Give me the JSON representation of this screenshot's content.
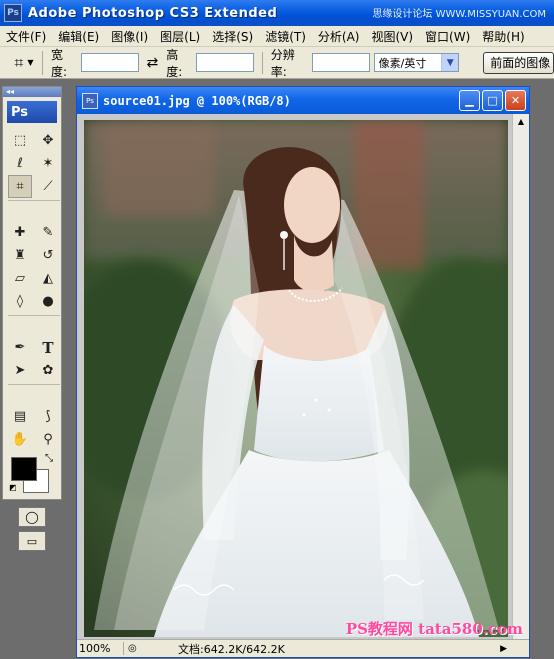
{
  "app": {
    "title": "Adobe Photoshop CS3 Extended",
    "icon": "ps-app-icon",
    "watermark_top": "思缘设计论坛 WWW.MISSYUAN.COM"
  },
  "menubar": {
    "items": [
      "文件(F)",
      "编辑(E)",
      "图像(I)",
      "图层(L)",
      "选择(S)",
      "滤镜(T)",
      "分析(A)",
      "视图(V)",
      "窗口(W)",
      "帮助(H)"
    ]
  },
  "options": {
    "width_label": "宽度:",
    "width_value": "",
    "height_label": "高度:",
    "height_value": "",
    "resolution_label": "分辨率:",
    "resolution_value": "",
    "unit_value": "像素/英寸",
    "front_image_button": "前面的图像"
  },
  "toolbox": {
    "logo": "Ps",
    "header": "◂◂"
  },
  "document": {
    "title": "source01.jpg @ 100%(RGB/8)",
    "zoom": "100%",
    "doc_info": "文档:642.2K/642.2K",
    "watermark_bottom": "PS教程网 tata580.com"
  },
  "colors": {
    "foreground": "#000000",
    "background": "#ffffff",
    "titlebar_blue": "#0a5fe0"
  }
}
